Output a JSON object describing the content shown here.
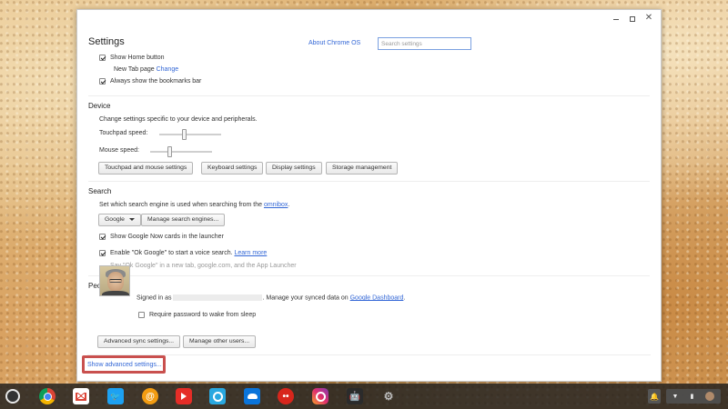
{
  "window": {
    "title": "Settings",
    "about_link": "About Chrome OS",
    "search_placeholder": "Search settings"
  },
  "appearance": {
    "show_home_button": "Show Home button",
    "new_tab_page_label": "New Tab page",
    "change_link": "Change",
    "show_bookmarks_bar": "Always show the bookmarks bar"
  },
  "device": {
    "title": "Device",
    "description": "Change settings specific to your device and peripherals.",
    "touchpad_speed_label": "Touchpad speed:",
    "touchpad_speed_value": 0.4,
    "mouse_speed_label": "Mouse speed:",
    "mouse_speed_value": 0.3,
    "buttons": [
      "Touchpad and mouse settings",
      "Keyboard settings",
      "Display settings",
      "Storage management"
    ]
  },
  "search": {
    "title": "Search",
    "description": "Set which search engine is used when searching from the",
    "omnibox_link": "omnibox",
    "description_end": ".",
    "engine_selected": "Google",
    "manage_button": "Manage search engines...",
    "google_now_label": "Show Google Now cards in the launcher",
    "ok_google_label": "Enable \"Ok Google\" to start a voice search.",
    "learn_more_link": "Learn more",
    "ok_google_hint": "Say \"Ok Google\" in a new tab, google.com, and the App Launcher"
  },
  "people": {
    "title": "People",
    "signed_in_as": "Signed in as",
    "manage_synced": ". Manage your synced data on",
    "dashboard_link": "Google Dashboard",
    "dashboard_end": ".",
    "require_password_label": "Require password to wake from sleep",
    "advanced_sync_button": "Advanced sync settings...",
    "manage_users_button": "Manage other users..."
  },
  "footer": {
    "show_advanced": "Show advanced settings..."
  },
  "shelf": {
    "apps": [
      "chrome-icon",
      "gmail-icon",
      "twitter-icon",
      "at-sign-icon",
      "youtube-icon",
      "camera-icon",
      "cloud-icon",
      "red-ball-icon",
      "instagram-icon",
      "android-icon",
      "settings-gear-icon"
    ]
  },
  "colors": {
    "link": "#3367d6",
    "highlight": "#c9504e",
    "search_border": "#7aa0e0"
  }
}
